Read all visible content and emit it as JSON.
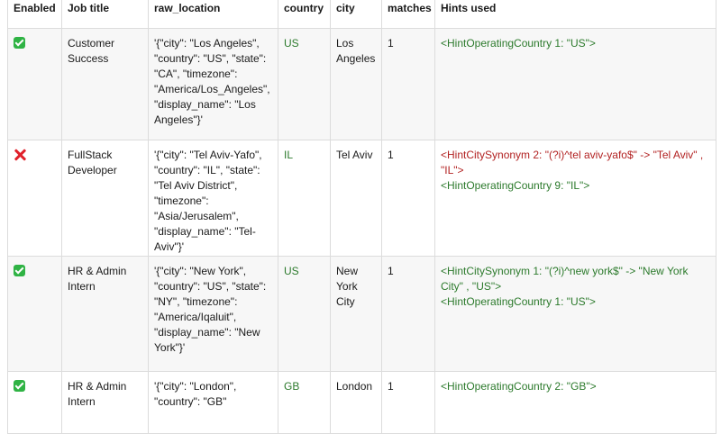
{
  "table": {
    "headers": {
      "enabled": "Enabled",
      "job_title": "Job title",
      "raw_location": "raw_location",
      "country": "country",
      "city": "city",
      "matches": "matches",
      "hints_used": "Hints used"
    },
    "rows": [
      {
        "enabled": true,
        "enabled_icon": "check-icon",
        "job_title": "Customer Success",
        "raw_location": "'{\"city\": \"Los Angeles\", \"country\": \"US\", \"state\": \"CA\", \"timezone\": \"America/Los_Angeles\", \"display_name\": \"Los Angeles\"}'",
        "country": "US",
        "city": "Los Angeles",
        "matches": "1",
        "hints": [
          {
            "text": "<HintOperatingCountry 1: \"US\">",
            "color": "#2c7a2c"
          }
        ]
      },
      {
        "enabled": false,
        "enabled_icon": "cross-icon",
        "job_title": "FullStack Developer",
        "raw_location": "'{\"city\": \"Tel Aviv-Yafo\", \"country\": \"IL\", \"state\": \"Tel Aviv District\", \"timezone\": \"Asia/Jerusalem\", \"display_name\": \"Tel-Aviv\"}'",
        "country": "IL",
        "city": "Tel Aviv",
        "matches": "1",
        "hints": [
          {
            "text": "<HintCitySynonym 2: \"(?i)^tel aviv-yafo$\" -> \"Tel Aviv\" , \"IL\">",
            "color": "#b22222"
          },
          {
            "text": "<HintOperatingCountry 9: \"IL\">",
            "color": "#2c7a2c"
          }
        ]
      },
      {
        "enabled": true,
        "enabled_icon": "check-icon",
        "job_title": "HR & Admin Intern",
        "raw_location": "'{\"city\": \"New York\", \"country\": \"US\", \"state\": \"NY\", \"timezone\": \"America/Iqaluit\", \"display_name\": \"New York\"}'",
        "country": "US",
        "city": "New York City",
        "matches": "1",
        "hints": [
          {
            "text": "<HintCitySynonym 1: \"(?i)^new york$\" -> \"New York City\" , \"US\">",
            "color": "#2c7a2c"
          },
          {
            "text": "<HintOperatingCountry 1: \"US\">",
            "color": "#2c7a2c"
          }
        ]
      },
      {
        "enabled": true,
        "enabled_icon": "check-icon",
        "job_title": "HR & Admin Intern",
        "raw_location": "'{\"city\": \"London\", \"country\": \"GB\"",
        "country": "GB",
        "city": "London",
        "matches": "1",
        "hints": [
          {
            "text": "<HintOperatingCountry 2: \"GB\">",
            "color": "#2c7a2c"
          }
        ]
      }
    ]
  }
}
